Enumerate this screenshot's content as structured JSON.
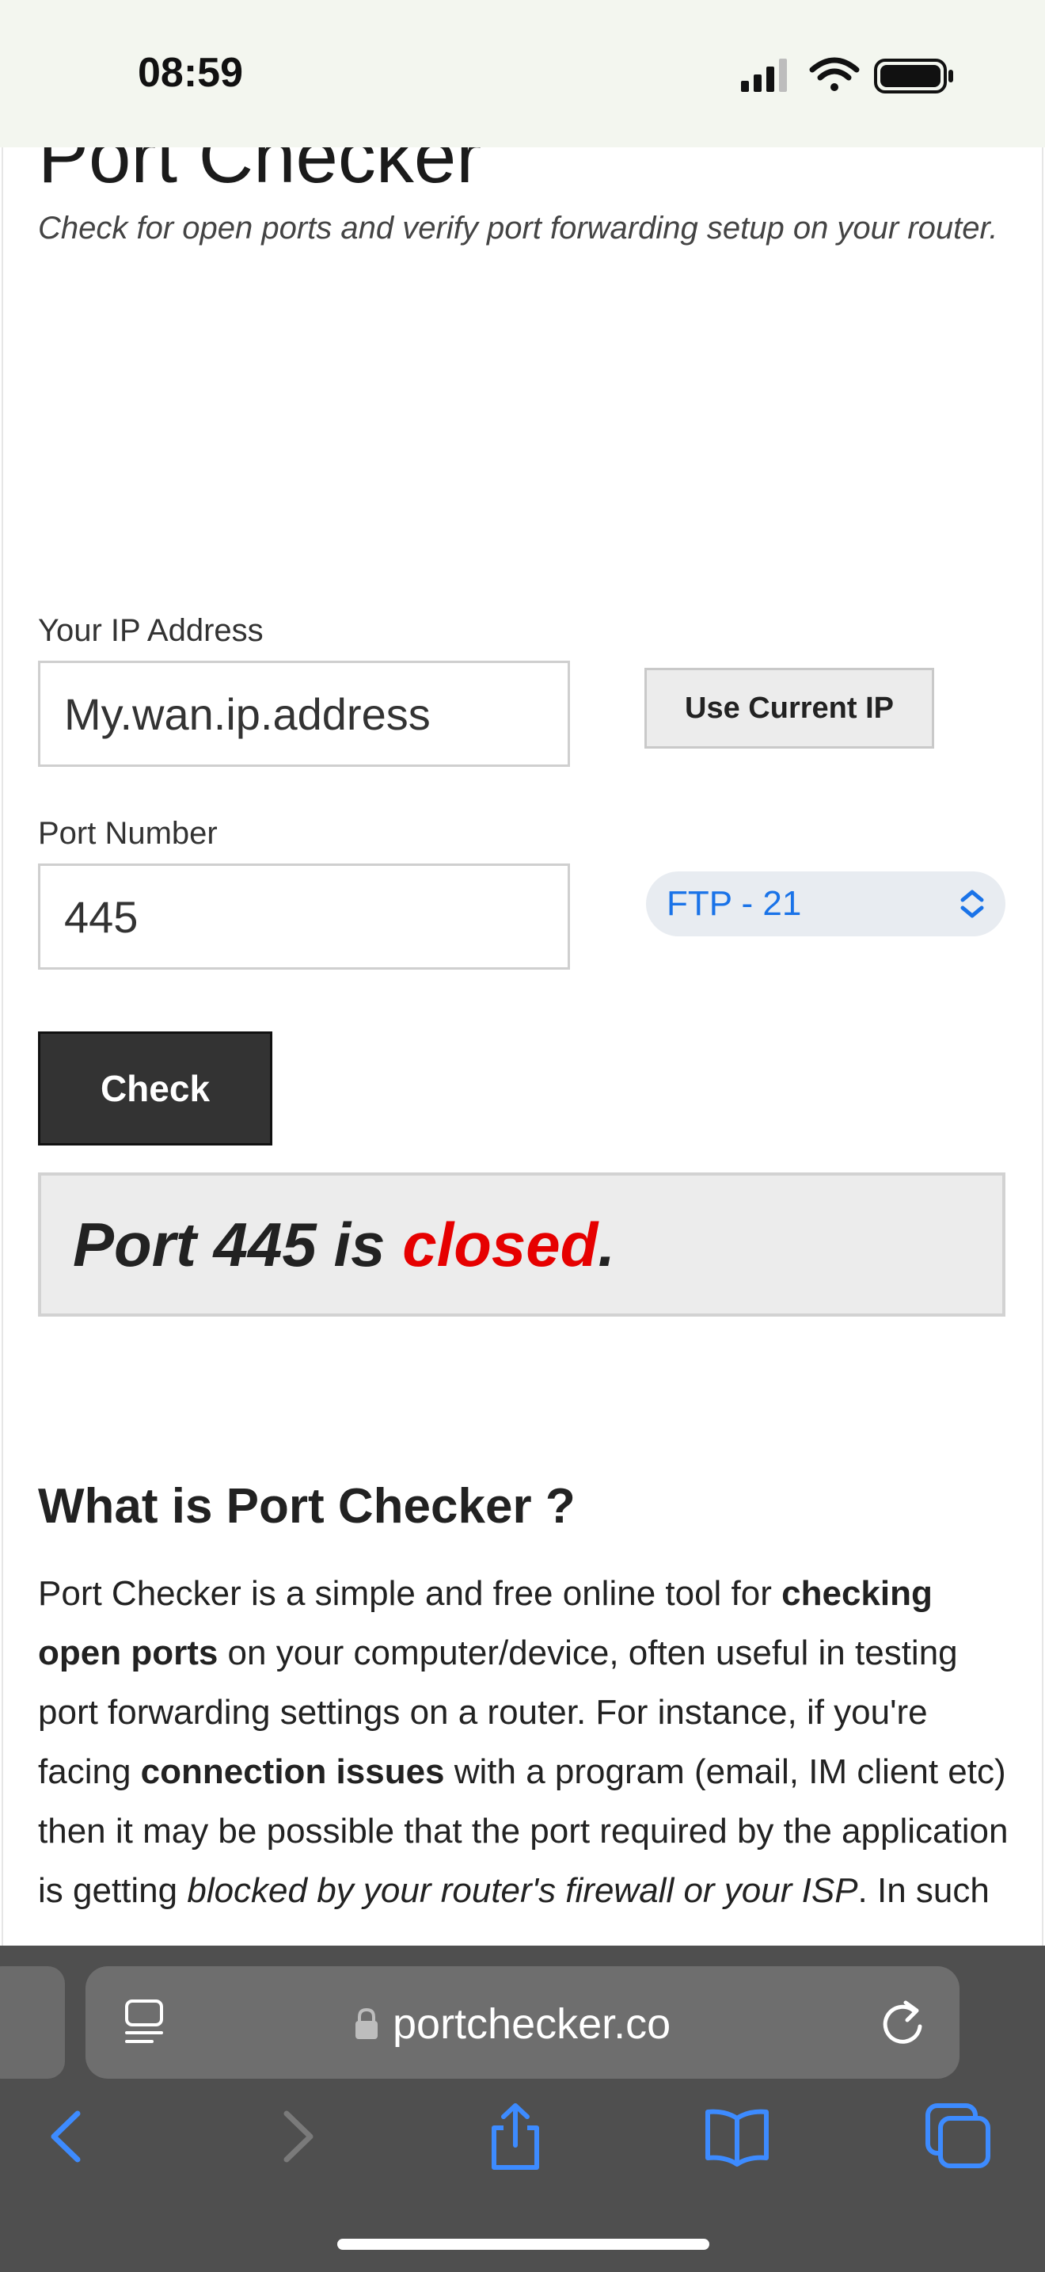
{
  "status_bar": {
    "time": "08:59"
  },
  "page": {
    "title": "Port Checker",
    "subtitle": "Check for open ports and verify port forwarding setup on your router.",
    "ip_label": "Your IP Address",
    "ip_value": "My.wan.ip.address",
    "use_current_ip": "Use Current IP",
    "port_label": "Port Number",
    "port_value": "445",
    "service_select": "FTP - 21",
    "check_button": "Check",
    "result": {
      "prefix": "Port 445 is ",
      "status": "closed",
      "suffix": "."
    },
    "section_heading": "What is Port Checker ?",
    "paragraph": [
      {
        "t": "Port Checker is a simple and free online tool for ",
        "s": "normal"
      },
      {
        "t": "checking open ports",
        "s": "bold"
      },
      {
        "t": " on your computer/device, often useful in testing port forwarding settings on a router. For instance, if you're facing ",
        "s": "normal"
      },
      {
        "t": "connection issues",
        "s": "bold"
      },
      {
        "t": " with a program (email, IM client etc) then it may be possible that the port required by the application is getting ",
        "s": "normal"
      },
      {
        "t": "blocked by your router's firewall or your ISP",
        "s": "italic"
      },
      {
        "t": ". In such",
        "s": "normal"
      }
    ]
  },
  "browser": {
    "url": "portchecker.co"
  },
  "colors": {
    "closed": "#e60000",
    "link_blue": "#1a73e8",
    "chrome_bg": "#4f4f4f"
  }
}
